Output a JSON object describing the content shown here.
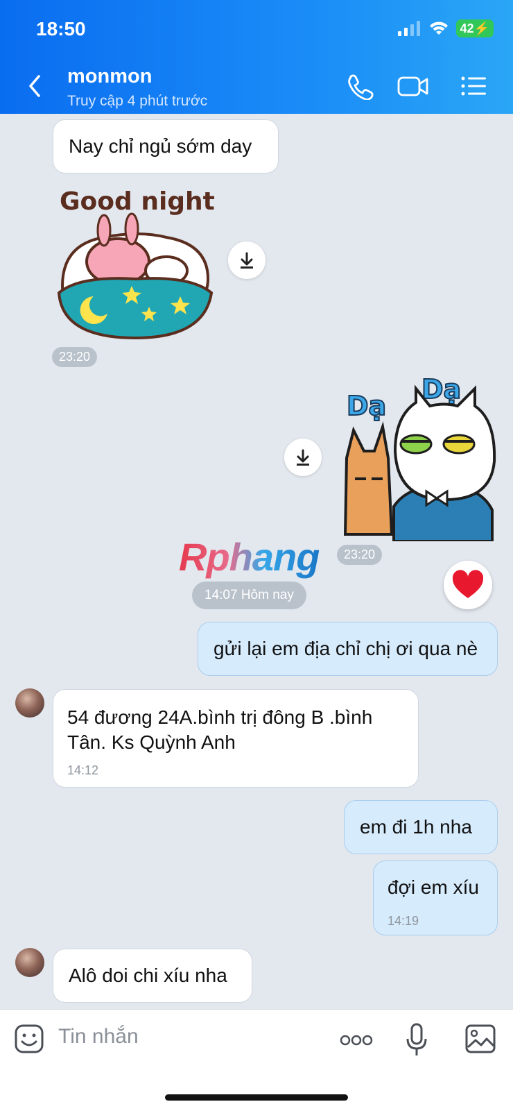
{
  "status_bar": {
    "time": "18:50",
    "battery": "42"
  },
  "header": {
    "contact_name": "monmon",
    "last_seen": "Truy cập 4 phút trước"
  },
  "messages": {
    "m1": {
      "text": "Nay chỉ ngủ sớm day"
    },
    "sticker1": {
      "caption": "Good night",
      "time": "23:20"
    },
    "sticker2": {
      "caption_left": "Dạ",
      "caption_right": "Dạ",
      "time": "23:20"
    },
    "day_divider": "14:07 Hôm nay",
    "m2": {
      "text": "gửi lại em địa chỉ chị ơi qua nè"
    },
    "m3": {
      "text_line1": "54 đương 24A.bình trị đông B .bình",
      "text_line2": "Tân. Ks Quỳnh Anh",
      "time": "14:12"
    },
    "m4": {
      "text": "em đi 1h nha"
    },
    "m5": {
      "text": "đợi em xíu",
      "time": "14:19"
    },
    "m6": {
      "text": "Alô doi chi xíu nha"
    }
  },
  "watermark": "Rphang",
  "composer": {
    "placeholder": "Tin nhắn"
  }
}
